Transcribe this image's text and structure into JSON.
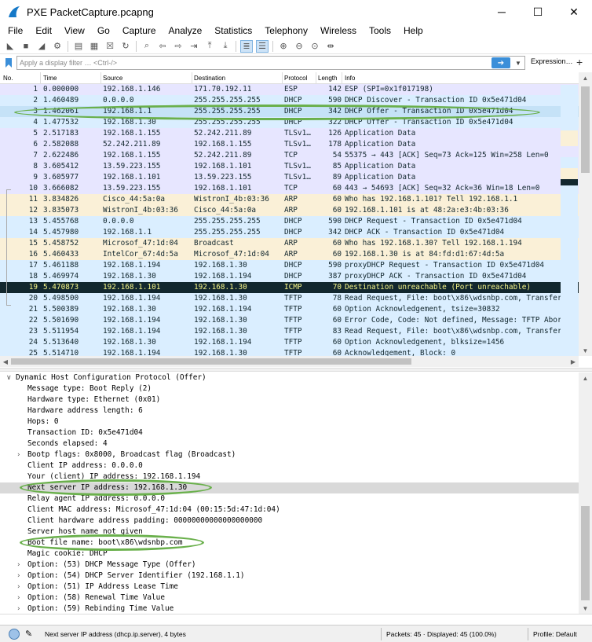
{
  "window": {
    "title": "PXE PacketCapture.pcapng",
    "minimize": "─",
    "maximize": "☐",
    "close": "✕"
  },
  "menu": [
    "File",
    "Edit",
    "View",
    "Go",
    "Capture",
    "Analyze",
    "Statistics",
    "Telephony",
    "Wireless",
    "Tools",
    "Help"
  ],
  "toolbar_icons": [
    "shark-fin-start-icon",
    "stop-icon",
    "restart-icon",
    "options-gear-icon",
    "open-folder-icon",
    "save-file-icon",
    "close-file-icon",
    "reload-icon",
    "find-icon",
    "go-back-icon",
    "go-forward-icon",
    "go-to-packet-icon",
    "go-first-icon",
    "go-last-icon",
    "autoscroll-icon",
    "colorize-icon",
    "zoom-in-icon",
    "zoom-out-icon",
    "normal-size-icon",
    "resize-columns-icon"
  ],
  "filter": {
    "placeholder": "Apply a display filter … <Ctrl-/>",
    "expression_label": "Expression…",
    "add_label": "+"
  },
  "packet_list": {
    "columns": [
      "No.",
      "Time",
      "Source",
      "Destination",
      "Protocol",
      "Length",
      "Info"
    ],
    "rows": [
      {
        "no": "1",
        "time": "0.000000",
        "src": "192.168.1.146",
        "dst": "171.70.192.11",
        "proto": "ESP",
        "len": "142",
        "info": "ESP (SPI=0x1f017198)",
        "bg": "#e7e6ff",
        "fg": "#12272e"
      },
      {
        "no": "2",
        "time": "1.460489",
        "src": "0.0.0.0",
        "dst": "255.255.255.255",
        "proto": "DHCP",
        "len": "590",
        "info": "DHCP Discover - Transaction ID 0x5e471d04",
        "bg": "#daeeff",
        "fg": "#12272e"
      },
      {
        "no": "3",
        "time": "1.462061",
        "src": "192.168.1.1",
        "dst": "255.255.255.255",
        "proto": "DHCP",
        "len": "342",
        "info": "DHCP Offer    - Transaction ID 0x5e471d04",
        "bg": "#c5e2f7",
        "fg": "#12272e"
      },
      {
        "no": "4",
        "time": "1.477532",
        "src": "192.168.1.30",
        "dst": "255.255.255.255",
        "proto": "DHCP",
        "len": "322",
        "info": "DHCP Offer    - Transaction ID 0x5e471d04",
        "bg": "#daeeff",
        "fg": "#12272e"
      },
      {
        "no": "5",
        "time": "2.517183",
        "src": "192.168.1.155",
        "dst": "52.242.211.89",
        "proto": "TLSv1…",
        "len": "126",
        "info": "Application Data",
        "bg": "#e7e6ff",
        "fg": "#12272e"
      },
      {
        "no": "6",
        "time": "2.582088",
        "src": "52.242.211.89",
        "dst": "192.168.1.155",
        "proto": "TLSv1…",
        "len": "178",
        "info": "Application Data",
        "bg": "#e7e6ff",
        "fg": "#12272e"
      },
      {
        "no": "7",
        "time": "2.622486",
        "src": "192.168.1.155",
        "dst": "52.242.211.89",
        "proto": "TCP",
        "len": "54",
        "info": "55375 → 443 [ACK] Seq=73 Ack=125 Win=258 Len=0",
        "bg": "#e7e6ff",
        "fg": "#12272e"
      },
      {
        "no": "8",
        "time": "3.605412",
        "src": "13.59.223.155",
        "dst": "192.168.1.101",
        "proto": "TLSv1…",
        "len": "85",
        "info": "Application Data",
        "bg": "#e7e6ff",
        "fg": "#12272e"
      },
      {
        "no": "9",
        "time": "3.605977",
        "src": "192.168.1.101",
        "dst": "13.59.223.155",
        "proto": "TLSv1…",
        "len": "89",
        "info": "Application Data",
        "bg": "#e7e6ff",
        "fg": "#12272e"
      },
      {
        "no": "10",
        "time": "3.666082",
        "src": "13.59.223.155",
        "dst": "192.168.1.101",
        "proto": "TCP",
        "len": "60",
        "info": "443 → 54693 [ACK] Seq=32 Ack=36 Win=18 Len=0",
        "bg": "#e7e6ff",
        "fg": "#12272e"
      },
      {
        "no": "11",
        "time": "3.834826",
        "src": "Cisco_44:5a:0a",
        "dst": "WistronI_4b:03:36",
        "proto": "ARP",
        "len": "60",
        "info": "Who has 192.168.1.101? Tell 192.168.1.1",
        "bg": "#faf0d7",
        "fg": "#12272e"
      },
      {
        "no": "12",
        "time": "3.835073",
        "src": "WistronI_4b:03:36",
        "dst": "Cisco_44:5a:0a",
        "proto": "ARP",
        "len": "60",
        "info": "192.168.1.101 is at 48:2a:e3:4b:03:36",
        "bg": "#faf0d7",
        "fg": "#12272e"
      },
      {
        "no": "13",
        "time": "5.455768",
        "src": "0.0.0.0",
        "dst": "255.255.255.255",
        "proto": "DHCP",
        "len": "590",
        "info": "DHCP Request  - Transaction ID 0x5e471d04",
        "bg": "#daeeff",
        "fg": "#12272e"
      },
      {
        "no": "14",
        "time": "5.457980",
        "src": "192.168.1.1",
        "dst": "255.255.255.255",
        "proto": "DHCP",
        "len": "342",
        "info": "DHCP ACK      - Transaction ID 0x5e471d04",
        "bg": "#daeeff",
        "fg": "#12272e"
      },
      {
        "no": "15",
        "time": "5.458752",
        "src": "Microsof_47:1d:04",
        "dst": "Broadcast",
        "proto": "ARP",
        "len": "60",
        "info": "Who has 192.168.1.30? Tell 192.168.1.194",
        "bg": "#faf0d7",
        "fg": "#12272e"
      },
      {
        "no": "16",
        "time": "5.460433",
        "src": "IntelCor_67:4d:5a",
        "dst": "Microsof_47:1d:04",
        "proto": "ARP",
        "len": "60",
        "info": "192.168.1.30 is at 84:fd:d1:67:4d:5a",
        "bg": "#faf0d7",
        "fg": "#12272e"
      },
      {
        "no": "17",
        "time": "5.461188",
        "src": "192.168.1.194",
        "dst": "192.168.1.30",
        "proto": "DHCP",
        "len": "590",
        "info": "proxyDHCP Request  - Transaction ID 0x5e471d04",
        "bg": "#daeeff",
        "fg": "#12272e"
      },
      {
        "no": "18",
        "time": "5.469974",
        "src": "192.168.1.30",
        "dst": "192.168.1.194",
        "proto": "DHCP",
        "len": "387",
        "info": "proxyDHCP ACK      - Transaction ID 0x5e471d04",
        "bg": "#daeeff",
        "fg": "#12272e"
      },
      {
        "no": "19",
        "time": "5.470873",
        "src": "192.168.1.101",
        "dst": "192.168.1.30",
        "proto": "ICMP",
        "len": "70",
        "info": "Destination unreachable (Port unreachable)",
        "bg": "#12272e",
        "fg": "#f7f78a"
      },
      {
        "no": "20",
        "time": "5.498500",
        "src": "192.168.1.194",
        "dst": "192.168.1.30",
        "proto": "TFTP",
        "len": "78",
        "info": "Read Request, File: boot\\x86\\wdsnbp.com, Transfer",
        "bg": "#daeeff",
        "fg": "#12272e"
      },
      {
        "no": "21",
        "time": "5.500389",
        "src": "192.168.1.30",
        "dst": "192.168.1.194",
        "proto": "TFTP",
        "len": "60",
        "info": "Option Acknowledgement, tsize=30832",
        "bg": "#daeeff",
        "fg": "#12272e"
      },
      {
        "no": "22",
        "time": "5.501690",
        "src": "192.168.1.194",
        "dst": "192.168.1.30",
        "proto": "TFTP",
        "len": "60",
        "info": "Error Code, Code: Not defined, Message: TFTP Abort",
        "bg": "#daeeff",
        "fg": "#12272e"
      },
      {
        "no": "23",
        "time": "5.511954",
        "src": "192.168.1.194",
        "dst": "192.168.1.30",
        "proto": "TFTP",
        "len": "83",
        "info": "Read Request, File: boot\\x86\\wdsnbp.com, Transfer",
        "bg": "#daeeff",
        "fg": "#12272e"
      },
      {
        "no": "24",
        "time": "5.513640",
        "src": "192.168.1.30",
        "dst": "192.168.1.194",
        "proto": "TFTP",
        "len": "60",
        "info": "Option Acknowledgement, blksize=1456",
        "bg": "#daeeff",
        "fg": "#12272e"
      },
      {
        "no": "25",
        "time": "5.514710",
        "src": "192.168.1.194",
        "dst": "192.168.1.30",
        "proto": "TFTP",
        "len": "60",
        "info": "Acknowledgement, Block: 0",
        "bg": "#daeeff",
        "fg": "#12272e"
      }
    ]
  },
  "details": {
    "rows": [
      {
        "text": "Dynamic Host Configuration Protocol (Offer)",
        "expander": "∨",
        "root": true
      },
      {
        "text": "Message type: Boot Reply (2)"
      },
      {
        "text": "Hardware type: Ethernet (0x01)"
      },
      {
        "text": "Hardware address length: 6"
      },
      {
        "text": "Hops: 0"
      },
      {
        "text": "Transaction ID: 0x5e471d04"
      },
      {
        "text": "Seconds elapsed: 4"
      },
      {
        "text": "Bootp flags: 0x8000, Broadcast flag (Broadcast)",
        "expander": "›"
      },
      {
        "text": "Client IP address: 0.0.0.0"
      },
      {
        "text": "Your (client) IP address: 192.168.1.194"
      },
      {
        "text": "Next server IP address: 192.168.1.30",
        "selected": true
      },
      {
        "text": "Relay agent IP address: 0.0.0.0"
      },
      {
        "text": "Client MAC address: Microsof_47:1d:04 (00:15:5d:47:1d:04)"
      },
      {
        "text": "Client hardware address padding: 00000000000000000000"
      },
      {
        "text": "Server host name not given"
      },
      {
        "text": "Boot file name: boot\\x86\\wdsnbp.com"
      },
      {
        "text": "Magic cookie: DHCP"
      },
      {
        "text": "Option: (53) DHCP Message Type (Offer)",
        "expander": "›"
      },
      {
        "text": "Option: (54) DHCP Server Identifier (192.168.1.1)",
        "expander": "›"
      },
      {
        "text": "Option: (51) IP Address Lease Time",
        "expander": "›"
      },
      {
        "text": "Option: (58) Renewal Time Value",
        "expander": "›"
      },
      {
        "text": "Option: (59) Rebinding Time Value",
        "expander": "›"
      }
    ]
  },
  "status": {
    "field_info": "Next server IP address (dhcp.ip.server), 4 bytes",
    "packets": "Packets: 45 · Displayed: 45 (100.0%)",
    "profile": "Profile: Default"
  },
  "colors": {
    "annotation": "#6ab04c",
    "selected_row": "#c5e2f7",
    "accent": "#3b8fd9"
  }
}
